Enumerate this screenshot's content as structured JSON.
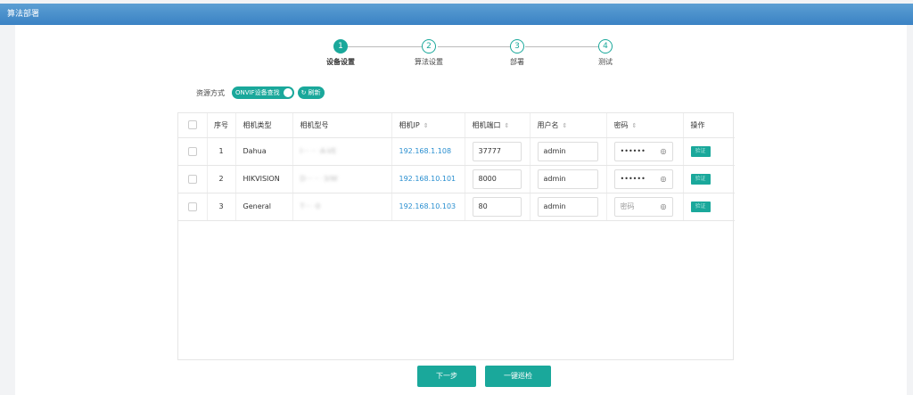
{
  "window": {
    "title": "算法部署"
  },
  "steps": [
    {
      "number": "1",
      "label": "设备设置",
      "active": true
    },
    {
      "number": "2",
      "label": "算法设置",
      "active": false
    },
    {
      "number": "3",
      "label": "部署",
      "active": false
    },
    {
      "number": "4",
      "label": "测试",
      "active": false
    }
  ],
  "source": {
    "label": "资源方式",
    "toggle_label": "ONVIF设备查找",
    "refresh_label": "刷新"
  },
  "table": {
    "headers": {
      "index": "序号",
      "camera_type": "相机类型",
      "camera_model": "相机型号",
      "camera_ip": "相机IP",
      "camera_port": "相机端口",
      "username": "用户名",
      "password": "密码",
      "action": "操作"
    },
    "rows": [
      {
        "index": "1",
        "camera_type": "Dahua",
        "camera_model": "I··· ·· ·A-VE",
        "ip": "192.168.1.108",
        "port": "37777",
        "username": "admin",
        "password": "••••••"
      },
      {
        "index": "2",
        "camera_type": "HIKVISION",
        "camera_model": "D··· ·· ·3/W",
        "ip": "192.168.10.101",
        "port": "8000",
        "username": "admin",
        "password": "••••••"
      },
      {
        "index": "3",
        "camera_type": "General",
        "camera_model": "T··· ·0",
        "ip": "192.168.10.103",
        "port": "80",
        "username": "admin",
        "password": "",
        "password_placeholder": "密码"
      }
    ],
    "action_label": "验证"
  },
  "footer": {
    "next_label": "下一步",
    "inspect_label": "一键巡检"
  }
}
